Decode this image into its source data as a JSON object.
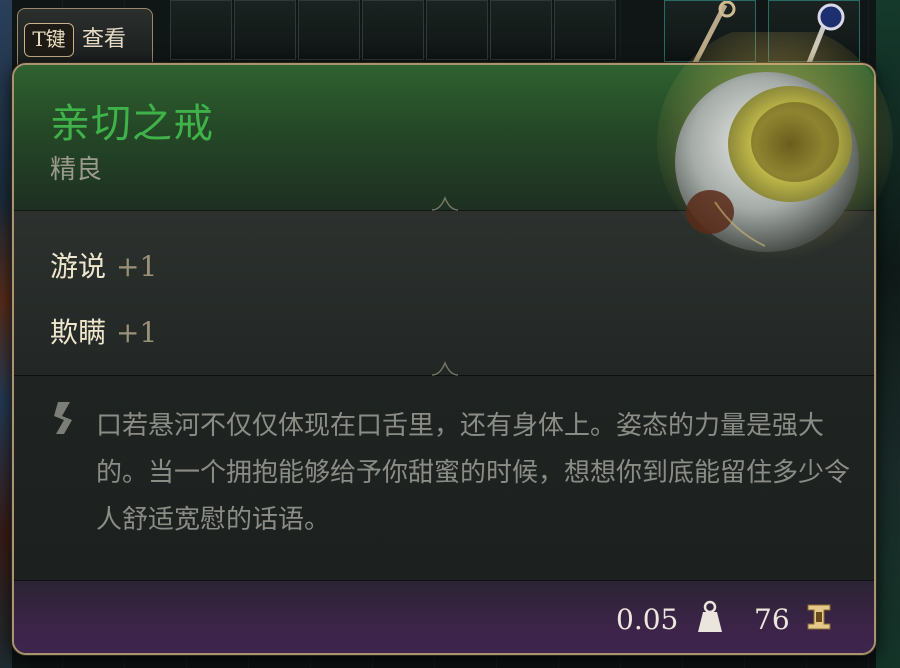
{
  "hint": {
    "key": "T键",
    "label": "查看"
  },
  "item": {
    "name": "亲切之戒",
    "rarity": "精良",
    "rarity_color": "#3fb24a",
    "icon": "ring-icon"
  },
  "properties": [
    {
      "name": "游说",
      "bonus": "+1"
    },
    {
      "name": "欺瞒",
      "bonus": "+1"
    }
  ],
  "description": "口若悬河不仅仅体现在口舌里，还有身体上。姿态的力量是强大的。当一个拥抱能够给予你甜蜜的时候，想想你到底能留住多少令人舒适宽慰的话语。",
  "footer": {
    "weight": "0.05",
    "weight_icon": "weight-icon",
    "price": "76",
    "price_icon": "gold-coin-icon"
  }
}
